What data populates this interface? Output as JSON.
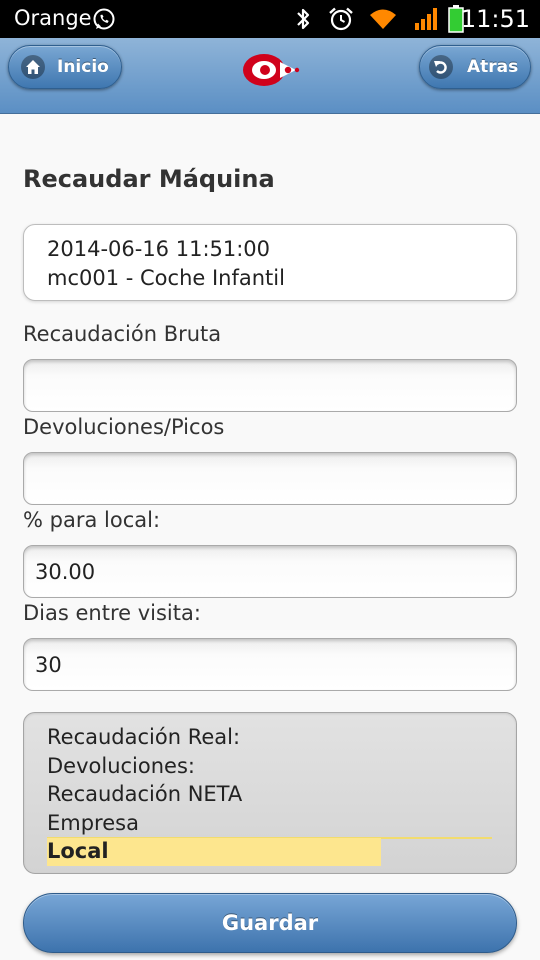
{
  "status_bar": {
    "carrier": "Orange",
    "time": "11:51",
    "icons": [
      "whatsapp-icon",
      "bluetooth-icon",
      "alarm-icon",
      "wifi-icon",
      "signal-icon",
      "battery-icon"
    ],
    "accent_color": "#ff8800",
    "battery_color": "#33cc33"
  },
  "header": {
    "home_label": "Inicio",
    "back_label": "Atras",
    "logo_color": "#d0021b"
  },
  "page": {
    "title": "Recaudar Máquina",
    "info_datetime": "2014-06-16 11:51:00",
    "info_machine": "mc001 - Coche Infantil"
  },
  "form": {
    "gross_label": "Recaudación Bruta",
    "gross_value": "",
    "returns_label": "Devoluciones/Picos",
    "returns_value": "",
    "percent_label": "% para local:",
    "percent_value": "30.00",
    "days_label": "Dias entre visita:",
    "days_value": "30"
  },
  "summary": {
    "real_label": "Recaudación Real:",
    "returns_label": "Devoluciones:",
    "net_label": "Recaudación NETA",
    "company_label": "Empresa",
    "local_label": "Local",
    "local_highlight_fraction": 0.75,
    "highlight_color": "#fde68e"
  },
  "actions": {
    "save_label": "Guardar"
  }
}
